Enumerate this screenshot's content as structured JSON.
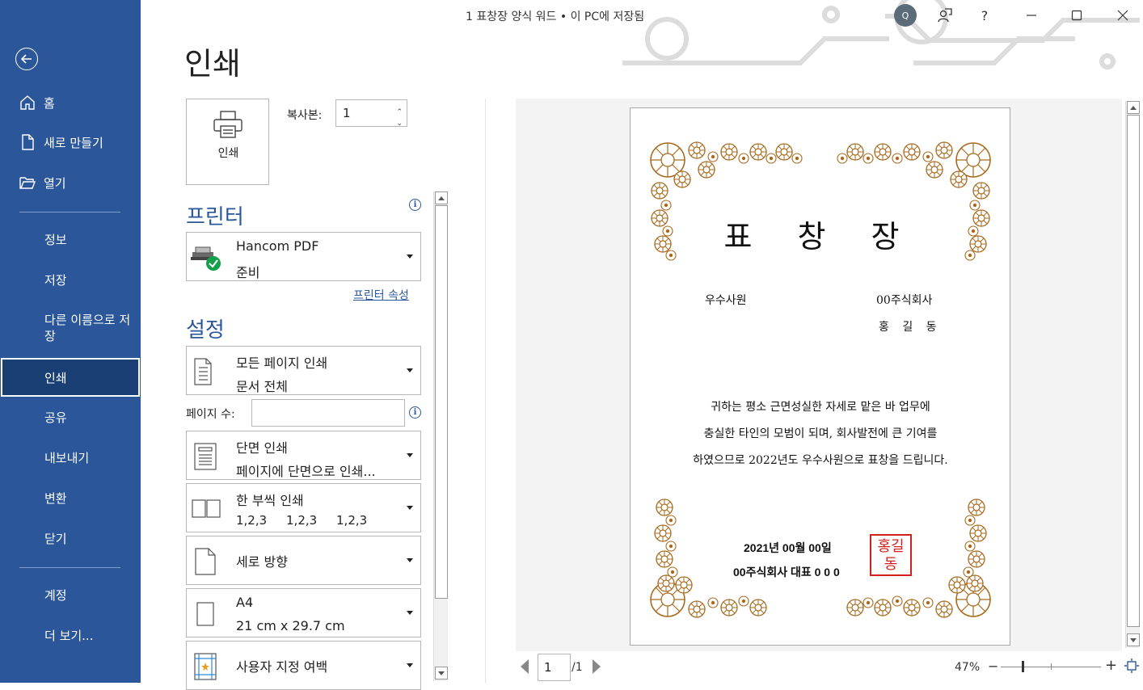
{
  "window": {
    "title": "1 표창장 양식 워드 • 이 PC에 저장됨",
    "avatar": "Q",
    "help": "?"
  },
  "sidebar": {
    "items": [
      {
        "label": "홈"
      },
      {
        "label": "새로 만들기"
      },
      {
        "label": "열기"
      },
      {
        "label": "정보"
      },
      {
        "label": "저장"
      },
      {
        "label": "다른 이름으로 저장"
      },
      {
        "label": "인쇄"
      },
      {
        "label": "공유"
      },
      {
        "label": "내보내기"
      },
      {
        "label": "변환"
      },
      {
        "label": "닫기"
      },
      {
        "label": "계정"
      },
      {
        "label": "더 보기..."
      }
    ],
    "active": "인쇄"
  },
  "print": {
    "title": "인쇄",
    "print_button": "인쇄",
    "copies_label": "복사본:",
    "copies_value": "1"
  },
  "printer": {
    "section_title": "프린터",
    "name": "Hancom PDF",
    "status": "준비",
    "properties_link": "프린터 속성"
  },
  "settings": {
    "section_title": "설정",
    "pages_label": "페이지 수:",
    "pages_value": "",
    "dropdowns": [
      {
        "line1": "모든 페이지 인쇄",
        "line2": "문서 전체",
        "icon": "pages-icon"
      },
      {
        "line1": "단면 인쇄",
        "line2": "페이지에 단면으로 인쇄...",
        "icon": "one-sided-icon"
      },
      {
        "line1": "한 부씩 인쇄",
        "line2": "1,2,3     1,2,3     1,2,3",
        "icon": "collate-icon"
      },
      {
        "line1": "세로 방향",
        "line2": "",
        "icon": "portrait-icon"
      },
      {
        "line1": "A4",
        "line2": "21 cm x 29.7 cm",
        "icon": "paper-size-icon"
      },
      {
        "line1": "사용자 지정 여백",
        "line2": "",
        "icon": "margins-icon"
      }
    ]
  },
  "preview": {
    "certificate": {
      "title": "표 창 장",
      "award_name": "우수사원",
      "company": "00주식회사",
      "recipient": "홍 길 동",
      "body_lines": [
        "귀하는 평소 근면성실한 자세로 맡은 바 업무에",
        "충실한 타인의 모범이 되며, 회사발전에 큰 기여를",
        "하였으므로 2022년도 우수사원으로 표창을 드립니다."
      ],
      "date": "2021년 00월 00일",
      "signer": "00주식회사 대표 0 0 0",
      "seal_text": "홍길동"
    },
    "page_current": "1",
    "page_total": "/1",
    "zoom": "47%",
    "zoom_minus": "−",
    "zoom_plus": "+"
  },
  "colors": {
    "sidebar": "#2b579a",
    "accent": "#2b579a",
    "ornament": "#a86a1e",
    "seal": "#d4201c"
  }
}
